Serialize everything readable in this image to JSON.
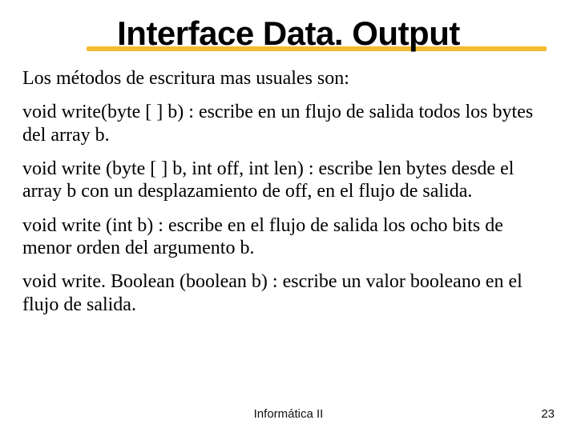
{
  "title": "Interface Data. Output",
  "intro": "Los métodos de escritura mas usuales son:",
  "paragraphs": [
    "void write(byte [ ] b) : escribe en un flujo de salida todos los bytes del array b.",
    "void write (byte [ ] b, int off, int len) : escribe len bytes desde el array b con un desplazamiento de off, en el flujo de salida.",
    "void write (int b) : escribe en el flujo de salida los ocho bits de menor orden del argumento b.",
    "void write. Boolean (boolean b) : escribe un valor booleano en el flujo de salida."
  ],
  "footer": {
    "center": "Informática II",
    "page": "23"
  }
}
